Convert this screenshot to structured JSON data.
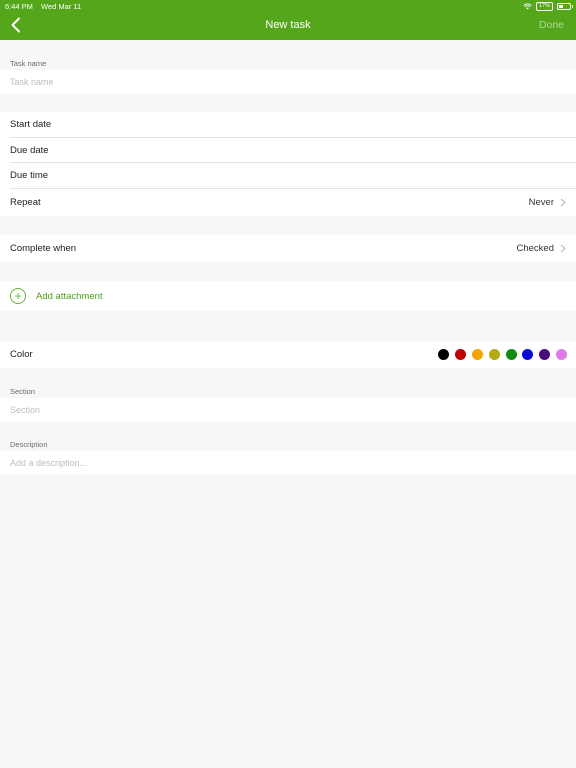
{
  "status_bar": {
    "time": "6:44 PM",
    "date": "Wed Mar 11",
    "battery_label": "17%"
  },
  "nav": {
    "title": "New task",
    "done": "Done"
  },
  "task_name": {
    "label": "Task name",
    "placeholder": "Task name"
  },
  "dates": {
    "start_date": "Start date",
    "due_date": "Due date",
    "due_time": "Due time",
    "repeat": "Repeat",
    "repeat_value": "Never"
  },
  "complete": {
    "label": "Complete when",
    "value": "Checked"
  },
  "attachment": {
    "label": "Add attachment"
  },
  "color": {
    "label": "Color",
    "options": [
      "#000000",
      "#c00000",
      "#f5a300",
      "#b5aa10",
      "#128a12",
      "#0b0bd6",
      "#4b0a80",
      "#e07ae8"
    ]
  },
  "section": {
    "label": "Section",
    "placeholder": "Section"
  },
  "description": {
    "label": "Description",
    "placeholder": "Add a description..."
  }
}
